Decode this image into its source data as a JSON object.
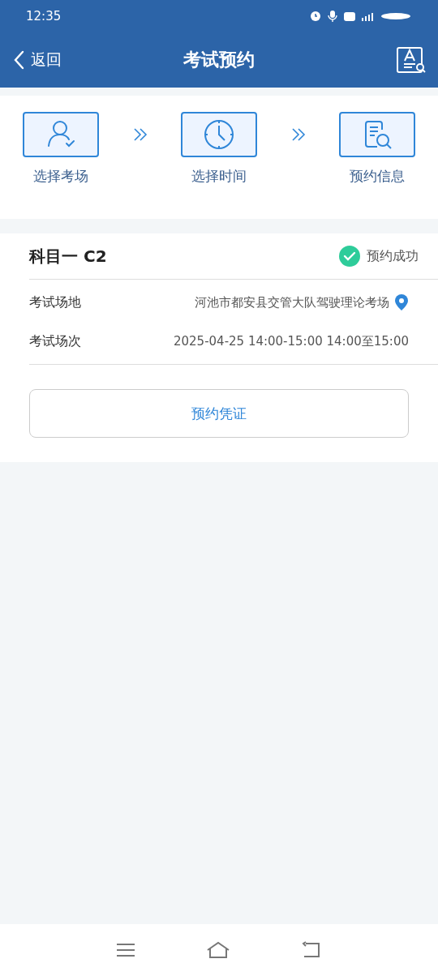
{
  "status_bar": {
    "time": "12:35"
  },
  "header": {
    "back": "返回",
    "title": "考试预约"
  },
  "steps": [
    {
      "kind": "person",
      "label": "选择考场"
    },
    {
      "kind": "clock",
      "label": "选择时间"
    },
    {
      "kind": "document",
      "label": "预约信息"
    }
  ],
  "booking": {
    "subject": "科目一 C2",
    "status": {
      "kind": "success",
      "text": "预约成功"
    },
    "fields": [
      {
        "label": "考试场地",
        "value": "河池市都安县交管大队驾驶理论考场",
        "kind": "location"
      },
      {
        "label": "考试场次",
        "value": "2025-04-25 14:00-15:00 14:00至15:00",
        "kind": "plain"
      }
    ],
    "button": "预约凭证"
  }
}
